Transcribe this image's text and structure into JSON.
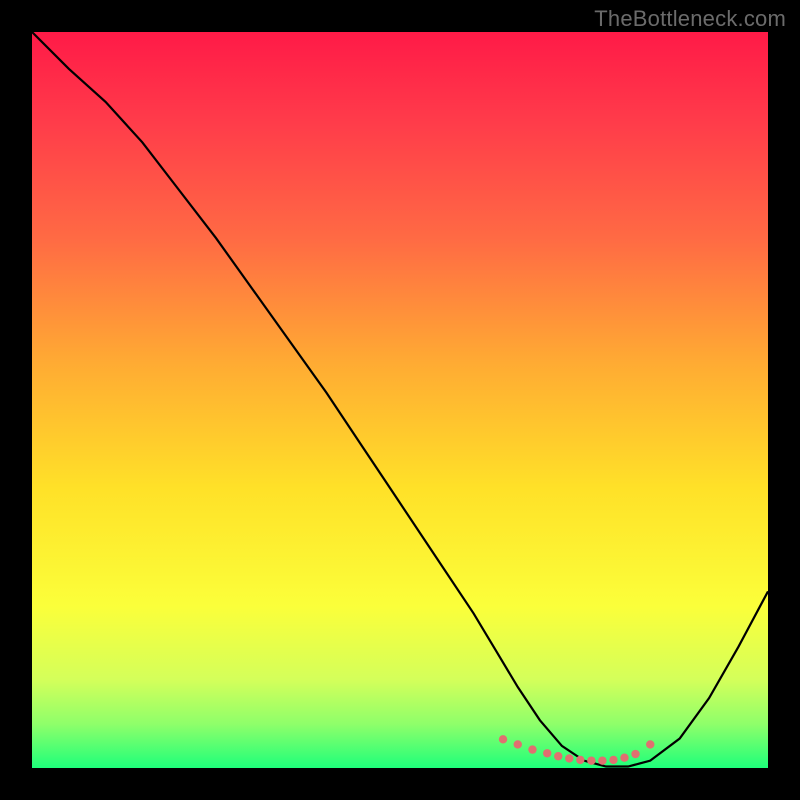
{
  "watermark": "TheBottleneck.com",
  "chart_data": {
    "type": "line",
    "title": "",
    "xlabel": "",
    "ylabel": "",
    "xlim": [
      0,
      100
    ],
    "ylim": [
      0,
      100
    ],
    "gradient_stops": [
      {
        "pct": 0,
        "color": "#ff1a47"
      },
      {
        "pct": 12,
        "color": "#ff3b4a"
      },
      {
        "pct": 28,
        "color": "#ff6a44"
      },
      {
        "pct": 45,
        "color": "#ffab33"
      },
      {
        "pct": 62,
        "color": "#ffe128"
      },
      {
        "pct": 78,
        "color": "#fbff3a"
      },
      {
        "pct": 88,
        "color": "#d4ff5a"
      },
      {
        "pct": 94,
        "color": "#8fff6a"
      },
      {
        "pct": 100,
        "color": "#1eff7a"
      }
    ],
    "series": [
      {
        "name": "bottleneck-curve",
        "color": "#000000",
        "width": 2.2,
        "x": [
          0,
          5,
          10,
          15,
          20,
          25,
          30,
          35,
          40,
          45,
          50,
          55,
          60,
          63,
          66,
          69,
          72,
          75,
          78,
          81,
          84,
          88,
          92,
          96,
          100
        ],
        "y": [
          100,
          95,
          90.5,
          85,
          78.5,
          72,
          65,
          58,
          51,
          43.5,
          36,
          28.5,
          21,
          16,
          11,
          6.5,
          3,
          1,
          0.2,
          0.2,
          1,
          4,
          9.5,
          16.5,
          24
        ]
      }
    ],
    "markers": {
      "name": "curve-dots",
      "color": "#e07070",
      "radius": 4.2,
      "x": [
        64,
        66,
        68,
        70,
        71.5,
        73,
        74.5,
        76,
        77.5,
        79,
        80.5,
        82,
        84
      ],
      "y": [
        3.9,
        3.2,
        2.5,
        2.0,
        1.6,
        1.3,
        1.1,
        1.0,
        1.0,
        1.1,
        1.4,
        1.9,
        3.2
      ]
    }
  }
}
